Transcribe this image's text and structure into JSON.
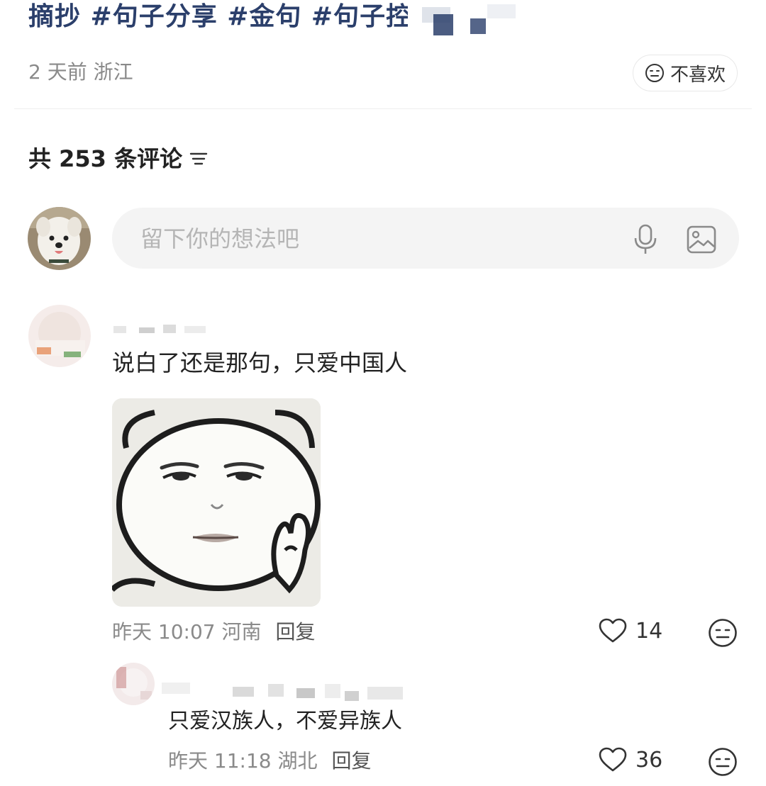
{
  "post": {
    "tags_text": "摘抄 #句子分享 #金句 #句子控 #",
    "time_location": "2 天前 浙江",
    "dislike_label": "不喜欢"
  },
  "comments_header": {
    "label": "共 253 条评论"
  },
  "composer": {
    "placeholder": "留下你的想法吧"
  },
  "comments": [
    {
      "text": "说白了还是那句，只爱中国人",
      "time_location": "昨天 10:07 河南",
      "reply_label": "回复",
      "likes": "14"
    },
    {
      "text": "只爱汉族人，不爱异族人",
      "time_location": "昨天 11:18 湖北",
      "reply_label": "回复",
      "likes": "36"
    }
  ],
  "colors": {
    "tag_text": "#2b3f6b",
    "meta_text": "#8a8a8a",
    "input_bg": "#f4f4f4"
  },
  "icons": [
    "neutral-face-icon",
    "sort-lines-icon",
    "microphone-icon",
    "image-icon",
    "heart-icon"
  ]
}
